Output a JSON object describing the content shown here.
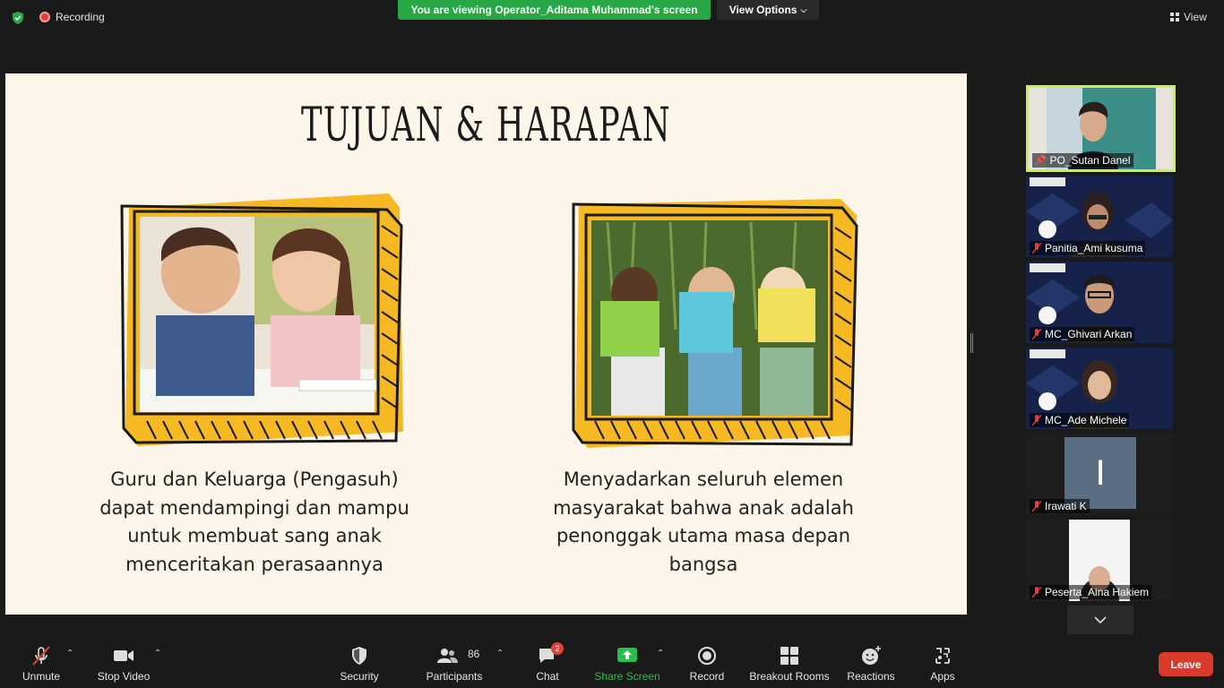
{
  "top": {
    "recording_label": "Recording",
    "viewing_banner": "You are viewing Operator_Aditama Muhammad's screen",
    "view_options_label": "View Options",
    "view_label": "View"
  },
  "slide": {
    "title": "TUJUAN & HARAPAN",
    "caption_left": "Guru dan Keluarga (Pengasuh) dapat mendampingi dan mampu untuk membuat sang anak menceritakan perasaannya",
    "caption_right": "Menyadarkan seluruh elemen masyarakat bahwa anak adalah penonggak utama masa depan bangsa",
    "caption_left_lines": [
      "Guru dan Keluarga (Pengasuh)",
      "dapat mendampingi dan mampu",
      "untuk membuat sang anak",
      "menceritakan perasaannya"
    ],
    "caption_right_lines": [
      "Menyadarkan seluruh elemen",
      "masyarakat bahwa anak adalah",
      "penonggak utama masa depan",
      "bangsa"
    ],
    "accent_color": "#f6b924"
  },
  "participants": [
    {
      "name": "PO_Sutan Danel",
      "active": true
    },
    {
      "name": "Panitia_Ami kusuma"
    },
    {
      "name": "MC_Ghivari Arkan"
    },
    {
      "name": "MC_Ade Michele"
    },
    {
      "name": "Irawati K",
      "initial": "I"
    },
    {
      "name": "Peserta_Aina Hakiem"
    }
  ],
  "toolbar": {
    "unmute": "Unmute",
    "stop_video": "Stop Video",
    "security": "Security",
    "participants": "Participants",
    "participants_count": "86",
    "chat": "Chat",
    "chat_badge": "2",
    "share_screen": "Share Screen",
    "record": "Record",
    "breakout_rooms": "Breakout Rooms",
    "reactions": "Reactions",
    "apps": "Apps",
    "leave": "Leave"
  }
}
